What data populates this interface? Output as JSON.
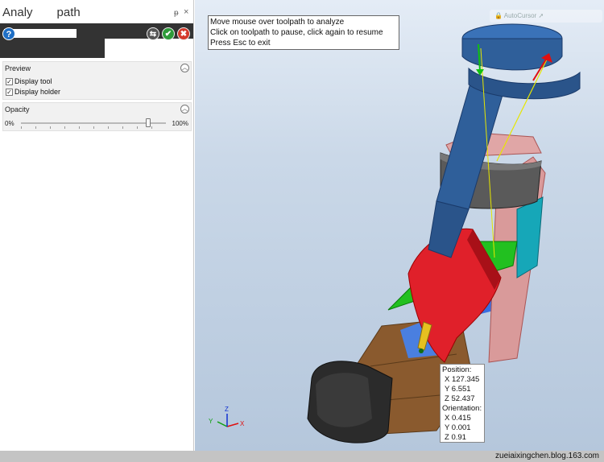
{
  "panel": {
    "title_left": "Analy",
    "title_right": "path",
    "pin": "ᵽ",
    "close": "×",
    "help_glyph": "?",
    "buttons": {
      "share": "⇆",
      "ok": "✔",
      "cancel": "✖"
    },
    "preview": {
      "title": "Preview",
      "display_tool": {
        "label": "Display tool",
        "checked": true
      },
      "display_holder": {
        "label": "Display holder",
        "checked": true
      }
    },
    "opacity": {
      "title": "Opacity",
      "min_label": "0%",
      "max_label": "100%",
      "value": 0.88
    }
  },
  "viewport": {
    "hint_lines": [
      "Move mouse over toolpath to analyze",
      "Click on toolpath to pause, click again to resume",
      "Press Esc to exit"
    ],
    "top_toolbar_label": "AutoCursor",
    "info": {
      "position_label": "Position:",
      "x": "X 127.345",
      "y": "Y 6.551",
      "z": "Z 52.437",
      "orientation_label": "Orientation:",
      "ox": "X 0.415",
      "oy": "Y 0.001",
      "oz": "Z 0.91"
    },
    "triad": {
      "x": "X",
      "y": "Y",
      "z": "Z"
    }
  },
  "footer": {
    "watermark": "zueiaixingchen.blog.163.com"
  },
  "colors": {
    "tool_blue": "#2f5f9a",
    "holder_gray": "#555555",
    "holder_pink": "#d99a9a",
    "surface_red": "#e0202a",
    "surface_green": "#22c020",
    "surface_cyan": "#16a7b8",
    "part_brown": "#8a5a2e",
    "part_dark": "#2a2a2a",
    "ok_green": "#2e9b3a",
    "cancel_red": "#d43a2c",
    "help_blue": "#1f6fc5"
  },
  "icons": [
    "help-icon",
    "share-icon",
    "ok-icon",
    "cancel-icon",
    "pin-icon",
    "close-icon",
    "collapse-icon",
    "lock-icon",
    "cursor-icon",
    "axis-triad-icon"
  ]
}
